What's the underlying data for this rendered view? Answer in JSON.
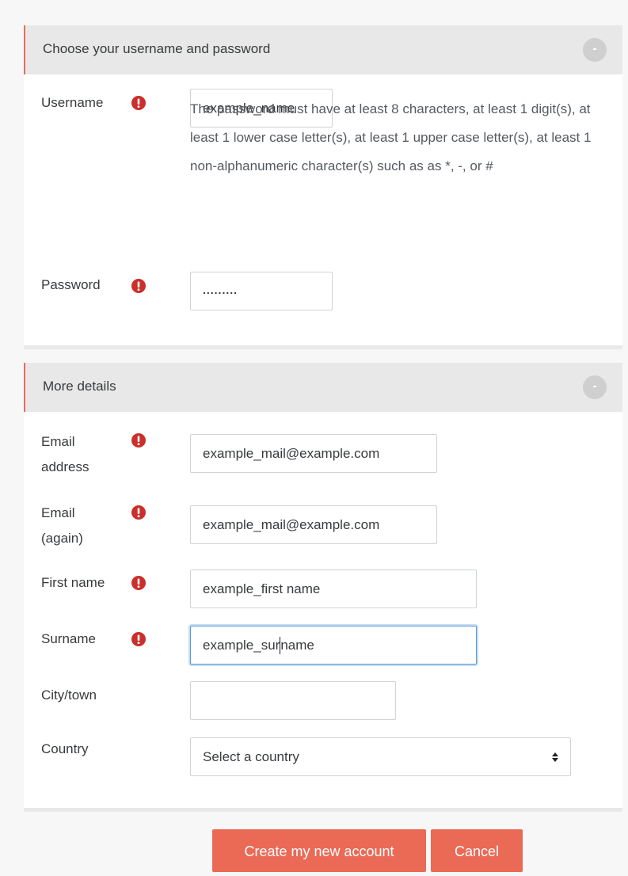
{
  "section1": {
    "title": "Choose your username and password",
    "toggle": "-",
    "username": {
      "label": "Username",
      "value": "example_name"
    },
    "password_help": "The password must have at least 8 characters, at least 1 digit(s), at least 1 lower case letter(s), at least 1 upper case letter(s), at least 1 non-alphanumeric character(s) such as as *, -, or #",
    "password": {
      "label": "Password",
      "value": "........."
    }
  },
  "section2": {
    "title": "More details",
    "toggle": "-",
    "email": {
      "label": "Email address",
      "value": "example_mail@example.com"
    },
    "email_again": {
      "label": "Email (again)",
      "value": "example_mail@example.com"
    },
    "first_name": {
      "label": "First name",
      "value": "example_first name"
    },
    "surname": {
      "label": "Surname",
      "value_before_cursor": "example_sur",
      "value_after_cursor": "name"
    },
    "city": {
      "label": "City/town",
      "value": ""
    },
    "country": {
      "label": "Country",
      "value": "Select a country"
    }
  },
  "actions": {
    "create_label": "Create my new account",
    "cancel_label": "Cancel"
  },
  "colors": {
    "accent": "#ea6a56",
    "required": "#c9302c",
    "focus": "#5d9bd6"
  }
}
